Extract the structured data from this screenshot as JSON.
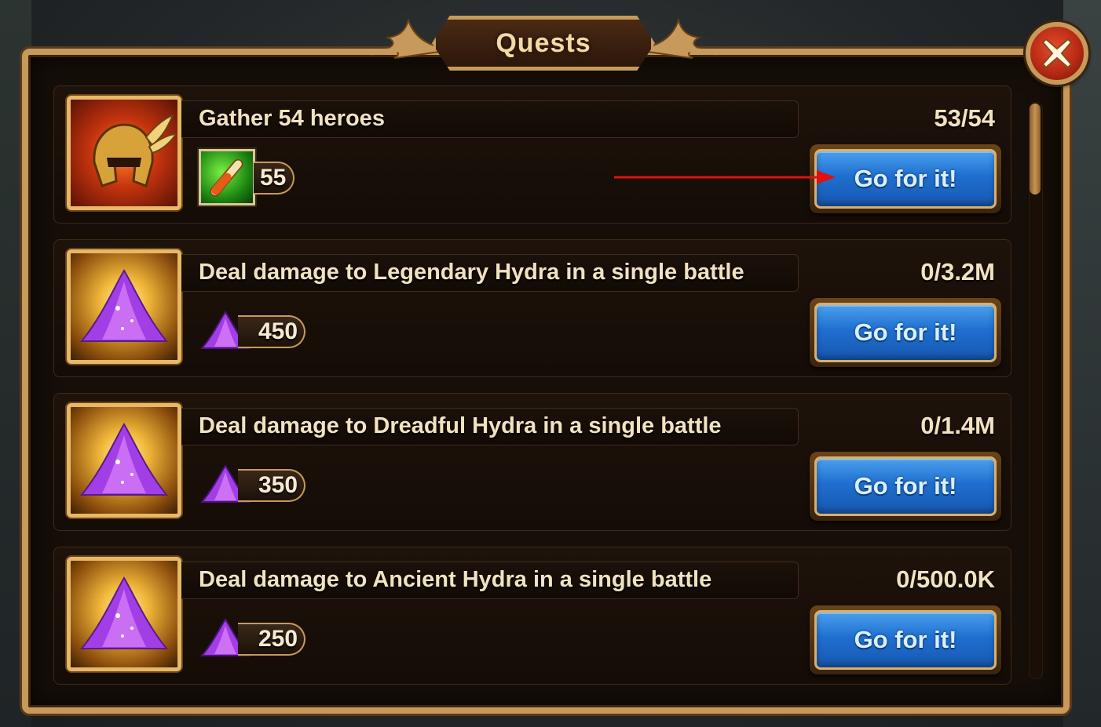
{
  "window": {
    "title": "Quests"
  },
  "close_button": {
    "icon": "close-icon"
  },
  "go_label": "Go for it!",
  "quests": [
    {
      "title": "Gather 54 heroes",
      "progress": "53/54",
      "reward_icon": "potion-icon",
      "reward_amount": "55",
      "icon": "helmet-icon"
    },
    {
      "title": "Deal damage to Legendary Hydra in a single battle",
      "progress": "0/3.2M",
      "reward_icon": "magic-dust-icon",
      "reward_amount": "450",
      "icon": "magic-dust-icon"
    },
    {
      "title": "Deal damage to Dreadful Hydra in a single battle",
      "progress": "0/1.4M",
      "reward_icon": "magic-dust-icon",
      "reward_amount": "350",
      "icon": "magic-dust-icon"
    },
    {
      "title": "Deal damage to Ancient Hydra in a single battle",
      "progress": "0/500.0K",
      "reward_icon": "magic-dust-icon",
      "reward_amount": "250",
      "icon": "magic-dust-icon"
    }
  ],
  "colors": {
    "frame": "#c79a5b",
    "button_blue": "#1f6fd0",
    "close_red": "#b82a14",
    "annotation_arrow": "#e01010"
  }
}
